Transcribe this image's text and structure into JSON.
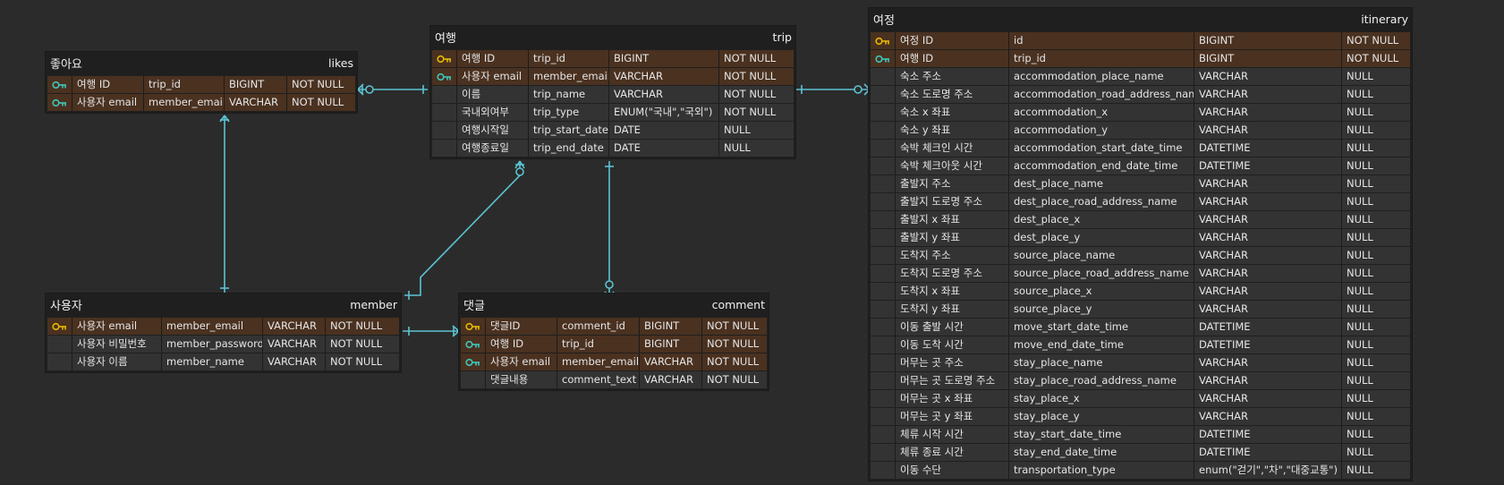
{
  "colors": {
    "background": "#2b2b2b",
    "pk_row": "#4a3120",
    "row": "#333333",
    "primary_key_icon": "#e6b800",
    "foreign_key_icon": "#3fc6b8",
    "connector": "#5bc3d2"
  },
  "entities": {
    "likes": {
      "title_ko": "좋아요",
      "title_en": "likes",
      "rows": [
        {
          "key": "foreign-key-icon",
          "name_ko": "여행 ID",
          "column": "trip_id",
          "type": "BIGINT",
          "nullable": "NOT NULL"
        },
        {
          "key": "foreign-key-icon",
          "name_ko": "사용자 email",
          "column": "member_email",
          "type": "VARCHAR",
          "nullable": "NOT NULL"
        }
      ]
    },
    "trip": {
      "title_ko": "여행",
      "title_en": "trip",
      "rows": [
        {
          "key": "primary-key-icon",
          "name_ko": "여행 ID",
          "column": "trip_id",
          "type": "BIGINT",
          "nullable": "NOT NULL"
        },
        {
          "key": "foreign-key-icon",
          "name_ko": "사용자 email",
          "column": "member_email",
          "type": "VARCHAR",
          "nullable": "NOT NULL"
        },
        {
          "key": "",
          "name_ko": "이름",
          "column": "trip_name",
          "type": "VARCHAR",
          "nullable": "NOT NULL"
        },
        {
          "key": "",
          "name_ko": "국내외여부",
          "column": "trip_type",
          "type": "ENUM(\"국내\",\"국외\")",
          "nullable": "NOT NULL"
        },
        {
          "key": "",
          "name_ko": "여행시작일",
          "column": "trip_start_date",
          "type": "DATE",
          "nullable": "NULL"
        },
        {
          "key": "",
          "name_ko": "여행종료일",
          "column": "trip_end_date",
          "type": "DATE",
          "nullable": "NULL"
        }
      ]
    },
    "itinerary": {
      "title_ko": "여정",
      "title_en": "itinerary",
      "rows": [
        {
          "key": "primary-key-icon",
          "name_ko": "여정 ID",
          "column": "id",
          "type": "BIGINT",
          "nullable": "NOT NULL"
        },
        {
          "key": "foreign-key-icon",
          "name_ko": "여행 ID",
          "column": "trip_id",
          "type": "BIGINT",
          "nullable": "NOT NULL"
        },
        {
          "key": "",
          "name_ko": "숙소 주소",
          "column": "accommodation_place_name",
          "type": "VARCHAR",
          "nullable": "NULL"
        },
        {
          "key": "",
          "name_ko": "숙소 도로명 주소",
          "column": "accommodation_road_address_name",
          "type": "VARCHAR",
          "nullable": "NULL"
        },
        {
          "key": "",
          "name_ko": "숙소 x 좌표",
          "column": "accommodation_x",
          "type": "VARCHAR",
          "nullable": "NULL"
        },
        {
          "key": "",
          "name_ko": "숙소 y 좌표",
          "column": "accommodation_y",
          "type": "VARCHAR",
          "nullable": "NULL"
        },
        {
          "key": "",
          "name_ko": "숙박 체크인 시간",
          "column": "accommodation_start_date_time",
          "type": "DATETIME",
          "nullable": "NULL"
        },
        {
          "key": "",
          "name_ko": "숙박 체크아웃 시간",
          "column": "accommodation_end_date_time",
          "type": "DATETIME",
          "nullable": "NULL"
        },
        {
          "key": "",
          "name_ko": "출발지 주소",
          "column": "dest_place_name",
          "type": "VARCHAR",
          "nullable": "NULL"
        },
        {
          "key": "",
          "name_ko": "출발지 도로명 주소",
          "column": "dest_place_road_address_name",
          "type": "VARCHAR",
          "nullable": "NULL"
        },
        {
          "key": "",
          "name_ko": "출발지 x 좌표",
          "column": "dest_place_x",
          "type": "VARCHAR",
          "nullable": "NULL"
        },
        {
          "key": "",
          "name_ko": "출발지 y 좌표",
          "column": "dest_place_y",
          "type": "VARCHAR",
          "nullable": "NULL"
        },
        {
          "key": "",
          "name_ko": "도착지 주소",
          "column": "source_place_name",
          "type": "VARCHAR",
          "nullable": "NULL"
        },
        {
          "key": "",
          "name_ko": "도착지 도로명 주소",
          "column": "source_place_road_address_name",
          "type": "VARCHAR",
          "nullable": "NULL"
        },
        {
          "key": "",
          "name_ko": "도착지 x 좌표",
          "column": "source_place_x",
          "type": "VARCHAR",
          "nullable": "NULL"
        },
        {
          "key": "",
          "name_ko": "도착지 y 좌표",
          "column": "source_place_y",
          "type": "VARCHAR",
          "nullable": "NULL"
        },
        {
          "key": "",
          "name_ko": "이동 출발 시간",
          "column": "move_start_date_time",
          "type": "DATETIME",
          "nullable": "NULL"
        },
        {
          "key": "",
          "name_ko": "이동 도착 시간",
          "column": "move_end_date_time",
          "type": "DATETIME",
          "nullable": "NULL"
        },
        {
          "key": "",
          "name_ko": "머무는 곳 주소",
          "column": "stay_place_name",
          "type": "VARCHAR",
          "nullable": "NULL"
        },
        {
          "key": "",
          "name_ko": "머무는 곳 도로명 주소",
          "column": "stay_place_road_address_name",
          "type": "VARCHAR",
          "nullable": "NULL"
        },
        {
          "key": "",
          "name_ko": "머무는 곳 x 좌표",
          "column": "stay_place_x",
          "type": "VARCHAR",
          "nullable": "NULL"
        },
        {
          "key": "",
          "name_ko": "머무는 곳 y 좌표",
          "column": "stay_place_y",
          "type": "VARCHAR",
          "nullable": "NULL"
        },
        {
          "key": "",
          "name_ko": "체류 시작 시간",
          "column": "stay_start_date_time",
          "type": "DATETIME",
          "nullable": "NULL"
        },
        {
          "key": "",
          "name_ko": "체류 종료 시간",
          "column": "stay_end_date_time",
          "type": "DATETIME",
          "nullable": "NULL"
        },
        {
          "key": "",
          "name_ko": "이동 수단",
          "column": "transportation_type",
          "type": "enum(\"걷기\",\"차\",\"대중교통\")",
          "nullable": "NULL"
        }
      ]
    },
    "member": {
      "title_ko": "사용자",
      "title_en": "member",
      "rows": [
        {
          "key": "primary-key-icon",
          "name_ko": "사용자 email",
          "column": "member_email",
          "type": "VARCHAR",
          "nullable": "NOT NULL"
        },
        {
          "key": "",
          "name_ko": "사용자 비밀번호",
          "column": "member_password",
          "type": "VARCHAR",
          "nullable": "NOT NULL"
        },
        {
          "key": "",
          "name_ko": "사용자 이름",
          "column": "member_name",
          "type": "VARCHAR",
          "nullable": "NOT NULL"
        }
      ]
    },
    "comment": {
      "title_ko": "댓글",
      "title_en": "comment",
      "rows": [
        {
          "key": "primary-key-icon",
          "name_ko": "댓글ID",
          "column": "comment_id",
          "type": "BIGINT",
          "nullable": "NOT NULL"
        },
        {
          "key": "foreign-key-icon",
          "name_ko": "여행 ID",
          "column": "trip_id",
          "type": "BIGINT",
          "nullable": "NOT NULL"
        },
        {
          "key": "foreign-key-icon",
          "name_ko": "사용자 email",
          "column": "member_email",
          "type": "VARCHAR",
          "nullable": "NOT NULL"
        },
        {
          "key": "",
          "name_ko": "댓글내용",
          "column": "comment_text",
          "type": "VARCHAR",
          "nullable": "NOT NULL"
        }
      ]
    }
  },
  "relationships": [
    {
      "from": "likes",
      "to": "trip"
    },
    {
      "from": "likes",
      "to": "member"
    },
    {
      "from": "trip",
      "to": "itinerary"
    },
    {
      "from": "trip",
      "to": "member"
    },
    {
      "from": "trip",
      "to": "comment"
    },
    {
      "from": "member",
      "to": "comment"
    }
  ]
}
